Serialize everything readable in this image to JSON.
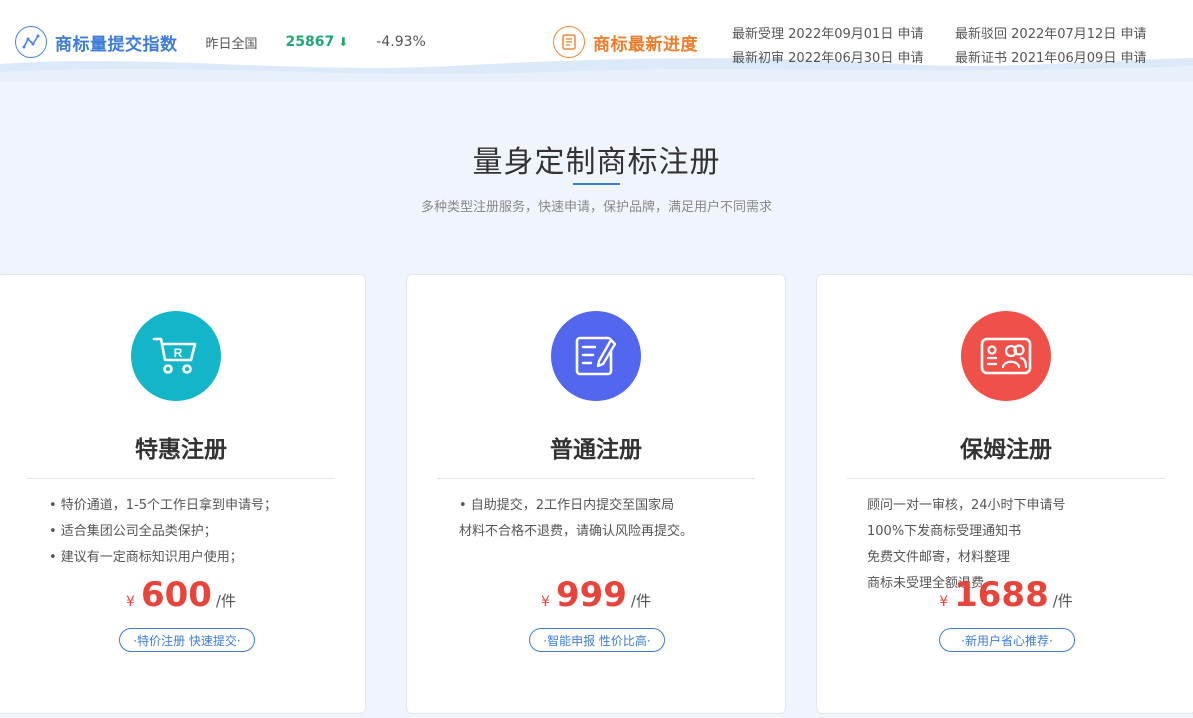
{
  "topbar": {
    "index_title": "商标量提交指数",
    "yesterday_label": "昨日全国",
    "yesterday_count": "25867",
    "yesterday_change": "-4.93%",
    "progress_title": "商标最新进度",
    "progress": [
      {
        "label": "最新受理",
        "date": "2022年09月01日",
        "suffix": "申请"
      },
      {
        "label": "最新驳回",
        "date": "2022年07月12日",
        "suffix": "申请"
      },
      {
        "label": "最新初审",
        "date": "2022年06月30日",
        "suffix": "申请"
      },
      {
        "label": "最新证书",
        "date": "2021年06月09日",
        "suffix": "申请"
      }
    ]
  },
  "section": {
    "title": "量身定制商标注册",
    "subtitle": "多种类型注册服务，快速申请，保护品牌，满足用户不同需求"
  },
  "cards": [
    {
      "title": "特惠注册",
      "icon": "cart-r-icon",
      "color": "#12b6c8",
      "features": [
        "• 特价通道，1-5个工作日拿到申请号；",
        "• 适合集团公司全品类保护；",
        "• 建议有一定商标知识用户使用；"
      ],
      "currency": "¥",
      "price": "600",
      "unit": "/件",
      "tag": "·特价注册 快速提交·"
    },
    {
      "title": "普通注册",
      "icon": "edit-doc-icon",
      "color": "#5266ee",
      "features": [
        "• 自助提交，2工作日内提交至国家局",
        "材料不合格不退费，请确认风险再提交。"
      ],
      "currency": "¥",
      "price": "999",
      "unit": "/件",
      "tag": "·智能申报 性价比高·"
    },
    {
      "title": "保姆注册",
      "icon": "id-card-icon",
      "color": "#f0504a",
      "features": [
        "顾问一对一审核，24小时下申请号",
        "100%下发商标受理通知书",
        "免费文件邮寄，材料整理",
        "商标未受理全额退费"
      ],
      "currency": "¥",
      "price": "1688",
      "unit": "/件",
      "tag": "·新用户省心推荐·"
    }
  ]
}
